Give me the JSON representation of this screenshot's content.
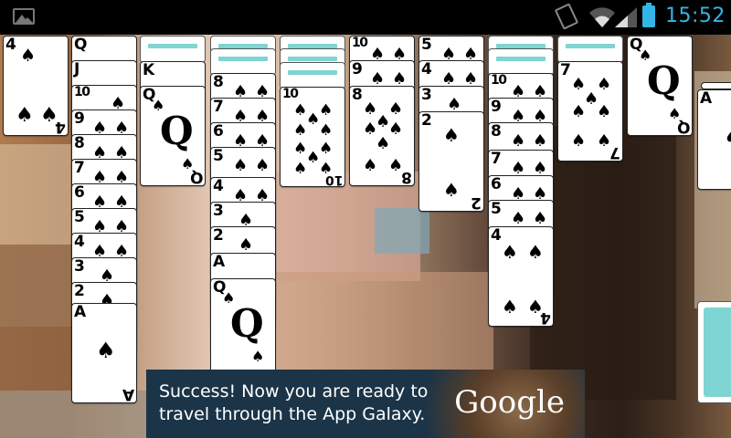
{
  "status_bar": {
    "time": "15:52",
    "icons": [
      "gallery-icon",
      "vibrate-icon",
      "wifi-icon",
      "signal-icon",
      "battery-icon"
    ],
    "accent_color": "#33b5e5"
  },
  "game": {
    "name": "spider-solitaire",
    "suit_symbol": "♠",
    "card_back_stripe_color": "#7fd4d4",
    "columns": [
      {
        "id": "col1",
        "facedown": 0,
        "cards": [
          "4"
        ]
      },
      {
        "id": "col2",
        "facedown": 0,
        "cards": [
          "Q",
          "J",
          "10",
          "9",
          "8",
          "7",
          "6",
          "5",
          "4",
          "3",
          "2",
          "A"
        ]
      },
      {
        "id": "col3",
        "facedown": 1,
        "cards": [
          "K",
          "Q"
        ]
      },
      {
        "id": "col4",
        "facedown": 2,
        "cards": [
          "8",
          "7",
          "6",
          "5",
          "4",
          "3",
          "2",
          "A",
          "Q"
        ]
      },
      {
        "id": "col5",
        "facedown": 3,
        "cards": [
          "10"
        ]
      },
      {
        "id": "col6",
        "facedown": 0,
        "cards": [
          "10",
          "9",
          "8"
        ]
      },
      {
        "id": "col7",
        "facedown": 0,
        "cards": [
          "5",
          "4",
          "3",
          "2"
        ]
      },
      {
        "id": "col8",
        "facedown": 2,
        "cards": [
          "10",
          "9",
          "8",
          "7",
          "6",
          "5",
          "4"
        ]
      },
      {
        "id": "col9",
        "facedown": 1,
        "cards": [
          "7"
        ]
      },
      {
        "id": "col10",
        "facedown": 0,
        "cards": [
          "Q"
        ]
      }
    ],
    "foundation_top_card": "A"
  },
  "ad": {
    "line1": "Success! Now you are ready to",
    "line2": "travel through the App Galaxy.",
    "brand": "Google"
  }
}
